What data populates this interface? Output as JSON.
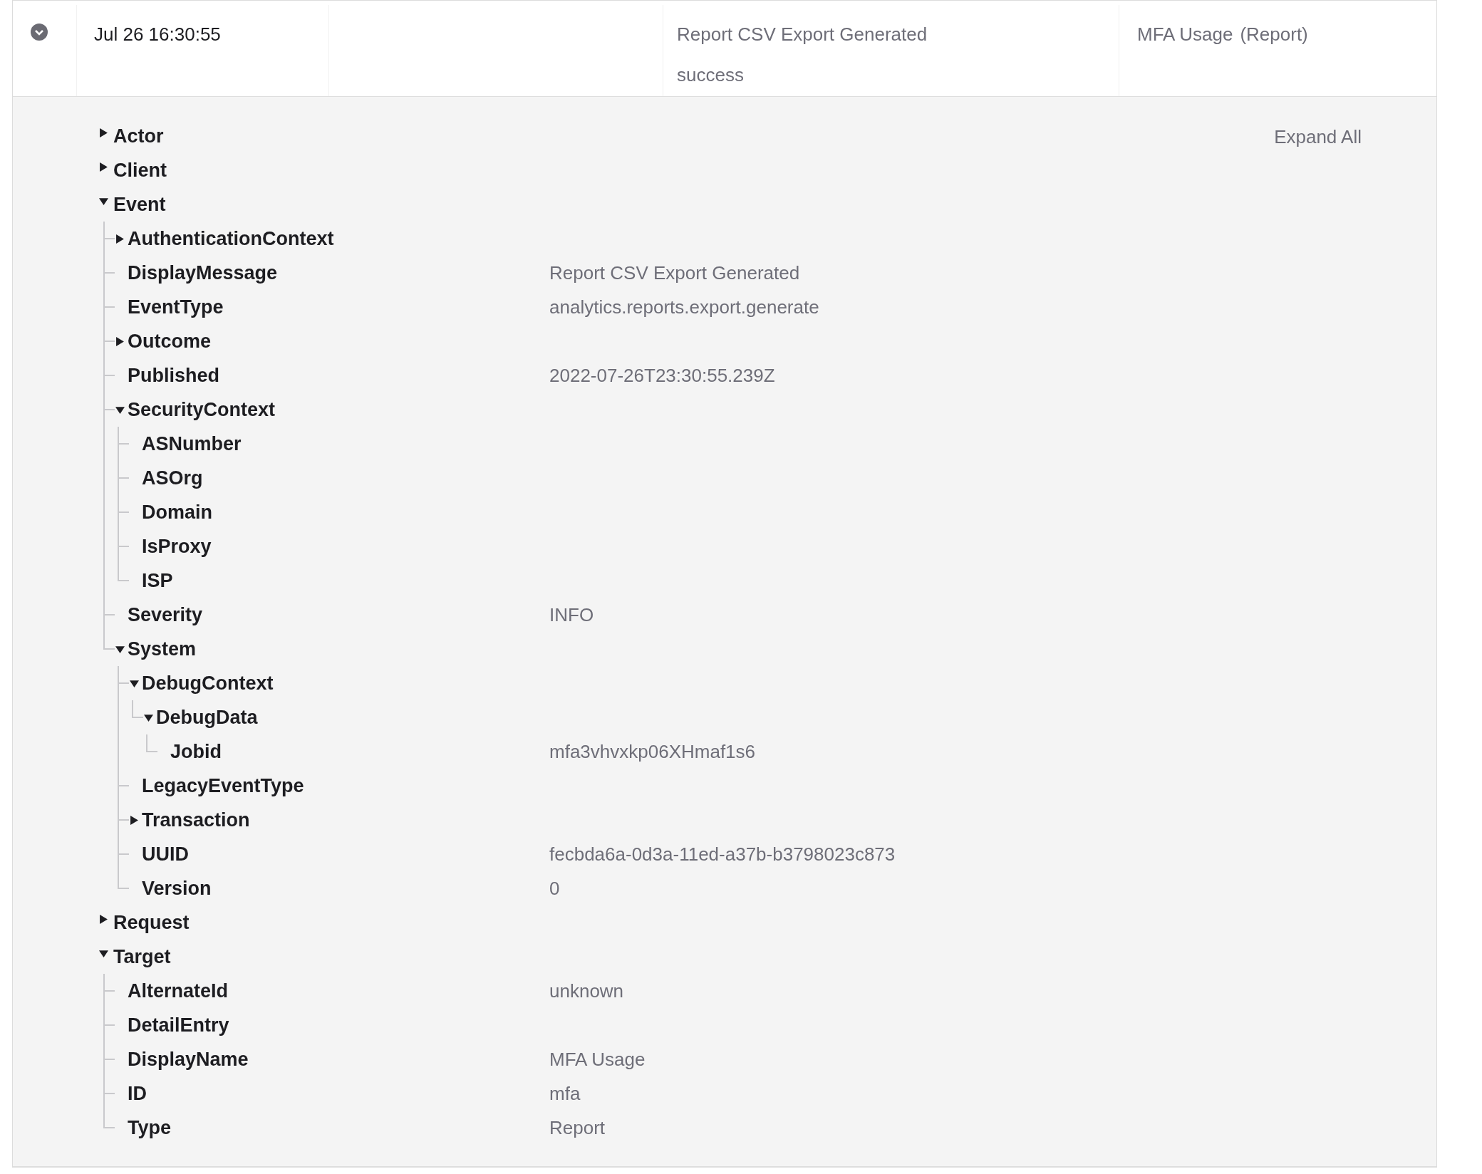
{
  "event_row": {
    "expanded": true,
    "time": "Jul 26 16:30:55",
    "message": "Report CSV Export Generated",
    "outcome": "success",
    "target_name": "MFA Usage",
    "target_type": "(Report)"
  },
  "expand_all": "Expand All",
  "tree": [
    {
      "label": "Actor",
      "expanded": false
    },
    {
      "label": "Client",
      "expanded": false
    },
    {
      "label": "Event",
      "expanded": true,
      "children": [
        {
          "label": "AuthenticationContext",
          "expanded": false
        },
        {
          "label": "DisplayMessage",
          "value": "Report CSV Export Generated"
        },
        {
          "label": "EventType",
          "value": "analytics.reports.export.generate"
        },
        {
          "label": "Outcome",
          "expanded": false
        },
        {
          "label": "Published",
          "value": "2022-07-26T23:30:55.239Z"
        },
        {
          "label": "SecurityContext",
          "expanded": true,
          "children": [
            {
              "label": "ASNumber"
            },
            {
              "label": "ASOrg"
            },
            {
              "label": "Domain"
            },
            {
              "label": "IsProxy"
            },
            {
              "label": "ISP"
            }
          ]
        },
        {
          "label": "Severity",
          "value": "INFO"
        },
        {
          "label": "System",
          "expanded": true,
          "children": [
            {
              "label": "DebugContext",
              "expanded": true,
              "children": [
                {
                  "label": "DebugData",
                  "expanded": true,
                  "children": [
                    {
                      "label": "Jobid",
                      "value": "mfa3vhvxkp06XHmaf1s6"
                    }
                  ]
                }
              ]
            },
            {
              "label": "LegacyEventType"
            },
            {
              "label": "Transaction",
              "expanded": false
            },
            {
              "label": "UUID",
              "value": "fecbda6a-0d3a-11ed-a37b-b3798023c873"
            },
            {
              "label": "Version",
              "value": "0"
            }
          ]
        }
      ]
    },
    {
      "label": "Request",
      "expanded": false
    },
    {
      "label": "Target",
      "expanded": true,
      "children": [
        {
          "label": "AlternateId",
          "value": "unknown"
        },
        {
          "label": "DetailEntry"
        },
        {
          "label": "DisplayName",
          "value": "MFA Usage"
        },
        {
          "label": "ID",
          "value": "mfa"
        },
        {
          "label": "Type",
          "value": "Report"
        }
      ]
    }
  ]
}
